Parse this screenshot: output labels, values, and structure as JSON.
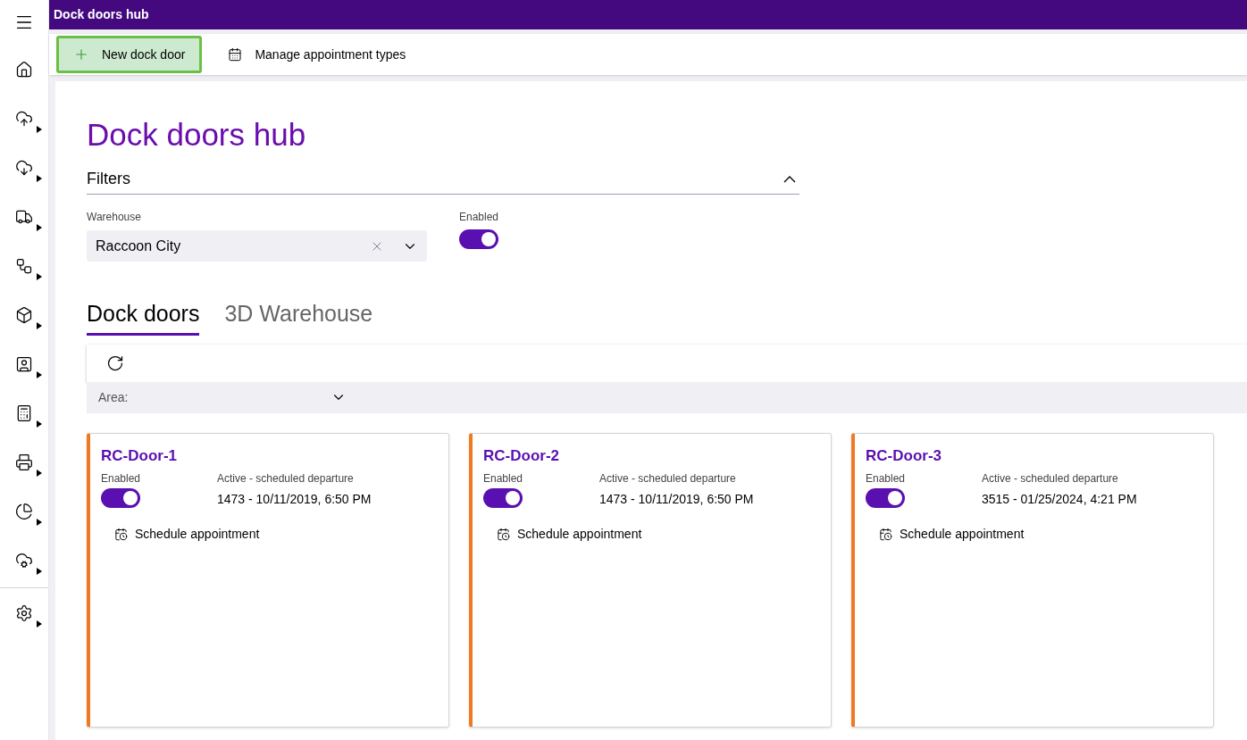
{
  "app_bar": {
    "title": "Dock doors hub"
  },
  "action_bar": {
    "buttons": [
      {
        "kind": "add",
        "label": "New dock door",
        "highlighted": true
      },
      {
        "kind": "calendar",
        "label": "Manage appointment types",
        "highlighted": false
      }
    ]
  },
  "page": {
    "title": "Dock doors hub"
  },
  "filters": {
    "title": "Filters",
    "expanded": true,
    "warehouse": {
      "label": "Warehouse",
      "value": "Raccoon City"
    },
    "enabled": {
      "label": "Enabled",
      "on": true
    }
  },
  "tabs": [
    {
      "label": "Dock doors",
      "selected": true
    },
    {
      "label": "3D Warehouse",
      "selected": false
    }
  ],
  "area": {
    "label": "Area:"
  },
  "cards": [
    {
      "title": "RC-Door-1",
      "enabled_label": "Enabled",
      "enabled": true,
      "status_label": "Active - scheduled departure",
      "status_value": "1473 - 10/11/2019, 6:50 PM",
      "action": "Schedule appointment"
    },
    {
      "title": "RC-Door-2",
      "enabled_label": "Enabled",
      "enabled": true,
      "status_label": "Active - scheduled departure",
      "status_value": "1473 - 10/11/2019, 6:50 PM",
      "action": "Schedule appointment"
    },
    {
      "title": "RC-Door-3",
      "enabled_label": "Enabled",
      "enabled": true,
      "status_label": "Active - scheduled departure",
      "status_value": "3515 - 01/25/2024, 4:21 PM",
      "action": "Schedule appointment"
    }
  ]
}
